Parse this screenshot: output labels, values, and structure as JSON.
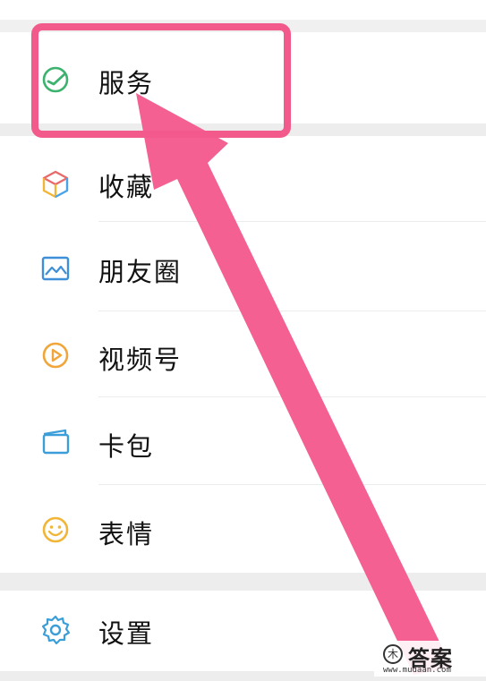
{
  "menu": {
    "items": [
      {
        "id": "services",
        "label": "服务",
        "icon": "check-circle-icon"
      },
      {
        "id": "favorites",
        "label": "收藏",
        "icon": "cube-icon"
      },
      {
        "id": "moments",
        "label": "朋友圈",
        "icon": "image-icon"
      },
      {
        "id": "channels",
        "label": "视频号",
        "icon": "play-circle-icon"
      },
      {
        "id": "cards",
        "label": "卡包",
        "icon": "wallet-icon"
      },
      {
        "id": "stickers",
        "label": "表情",
        "icon": "smile-icon"
      },
      {
        "id": "settings",
        "label": "设置",
        "icon": "gear-icon"
      }
    ]
  },
  "annotation": {
    "highlight_color": "#f35a8c",
    "target": "services"
  },
  "watermark": {
    "logo": "木",
    "text": "答案",
    "url": "www.mudaan.com"
  }
}
